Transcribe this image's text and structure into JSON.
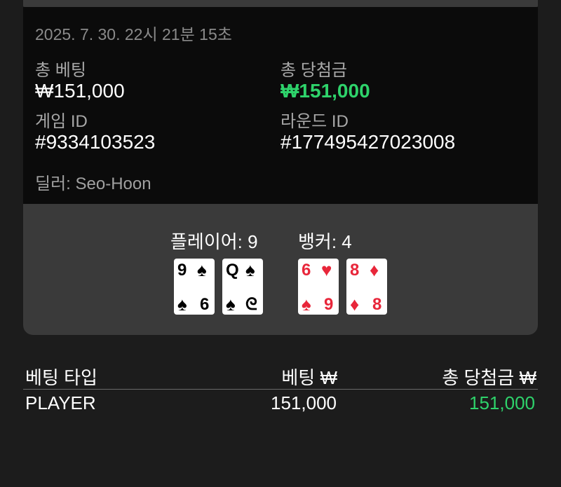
{
  "summary": {
    "timestamp": "2025. 7. 30. 22시 21분 15초",
    "total_bet_label": "총 베팅",
    "total_bet_value": "₩151,000",
    "total_win_label": "총 당첨금",
    "total_win_value": "₩151,000",
    "game_id_label": "게임 ID",
    "game_id_value": "#9334103523",
    "round_id_label": "라운드 ID",
    "round_id_value": "#177495427023008",
    "dealer": "딜러: Seo-Hoon"
  },
  "hands": {
    "player_label": "플레이어: 9",
    "banker_label": "뱅커: 4",
    "player_cards": [
      {
        "rank": "9",
        "suit": "♠",
        "color": "#000000",
        "rank_bottom": "6",
        "suit_bottom": "♠"
      },
      {
        "rank": "Q",
        "suit": "♠",
        "color": "#000000",
        "rank_bottom": "ᘓ",
        "suit_bottom": "♠"
      }
    ],
    "banker_cards": [
      {
        "rank": "6",
        "suit": "♥",
        "color": "#e8263a",
        "rank_bottom": "9",
        "suit_bottom": "♠"
      },
      {
        "rank": "8",
        "suit": "♦",
        "color": "#e8263a",
        "rank_bottom": "8",
        "suit_bottom": "♦"
      }
    ]
  },
  "bets_table": {
    "headers": [
      "베팅 타입",
      "베팅 ₩",
      "총 당첨금 ₩"
    ],
    "rows": [
      {
        "type": "PLAYER",
        "bet": "151,000",
        "win": "151,000"
      }
    ]
  },
  "colors": {
    "win_green": "#2ed36b",
    "card_red": "#e8263a",
    "panel_bg": "#0b0b0b",
    "card_bg": "#3a3a3a",
    "page_bg": "#1c1c1c"
  }
}
